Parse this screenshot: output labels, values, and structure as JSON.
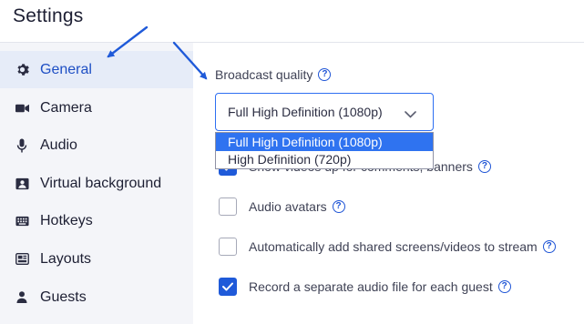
{
  "header": {
    "title": "Settings"
  },
  "sidebar": {
    "items": [
      {
        "label": "General",
        "icon": "gear-icon",
        "active": true
      },
      {
        "label": "Camera",
        "icon": "video-camera-icon"
      },
      {
        "label": "Audio",
        "icon": "microphone-icon"
      },
      {
        "label": "Virtual background",
        "icon": "portrait-icon"
      },
      {
        "label": "Hotkeys",
        "icon": "keyboard-icon"
      },
      {
        "label": "Layouts",
        "icon": "layout-icon"
      },
      {
        "label": "Guests",
        "icon": "person-icon"
      }
    ]
  },
  "main": {
    "broadcast_quality": {
      "label": "Broadcast quality",
      "help": "?",
      "selected": "Full High Definition (1080p)",
      "options": [
        "Full High Definition (1080p)",
        "High Definition (720p)"
      ]
    },
    "checkboxes": [
      {
        "label": "Show videos up for comments, banners",
        "checked": true
      },
      {
        "label": "Audio avatars",
        "checked": false
      },
      {
        "label": "Automatically add shared screens/videos to stream",
        "checked": false
      },
      {
        "label": "Record a separate audio file for each guest",
        "checked": true
      }
    ]
  },
  "colors": {
    "accent": "#1f5ad9",
    "active_bg": "#e6ecf8",
    "sidebar_bg": "#f4f5f9",
    "annotation_arrow": "#1f5ad9"
  }
}
